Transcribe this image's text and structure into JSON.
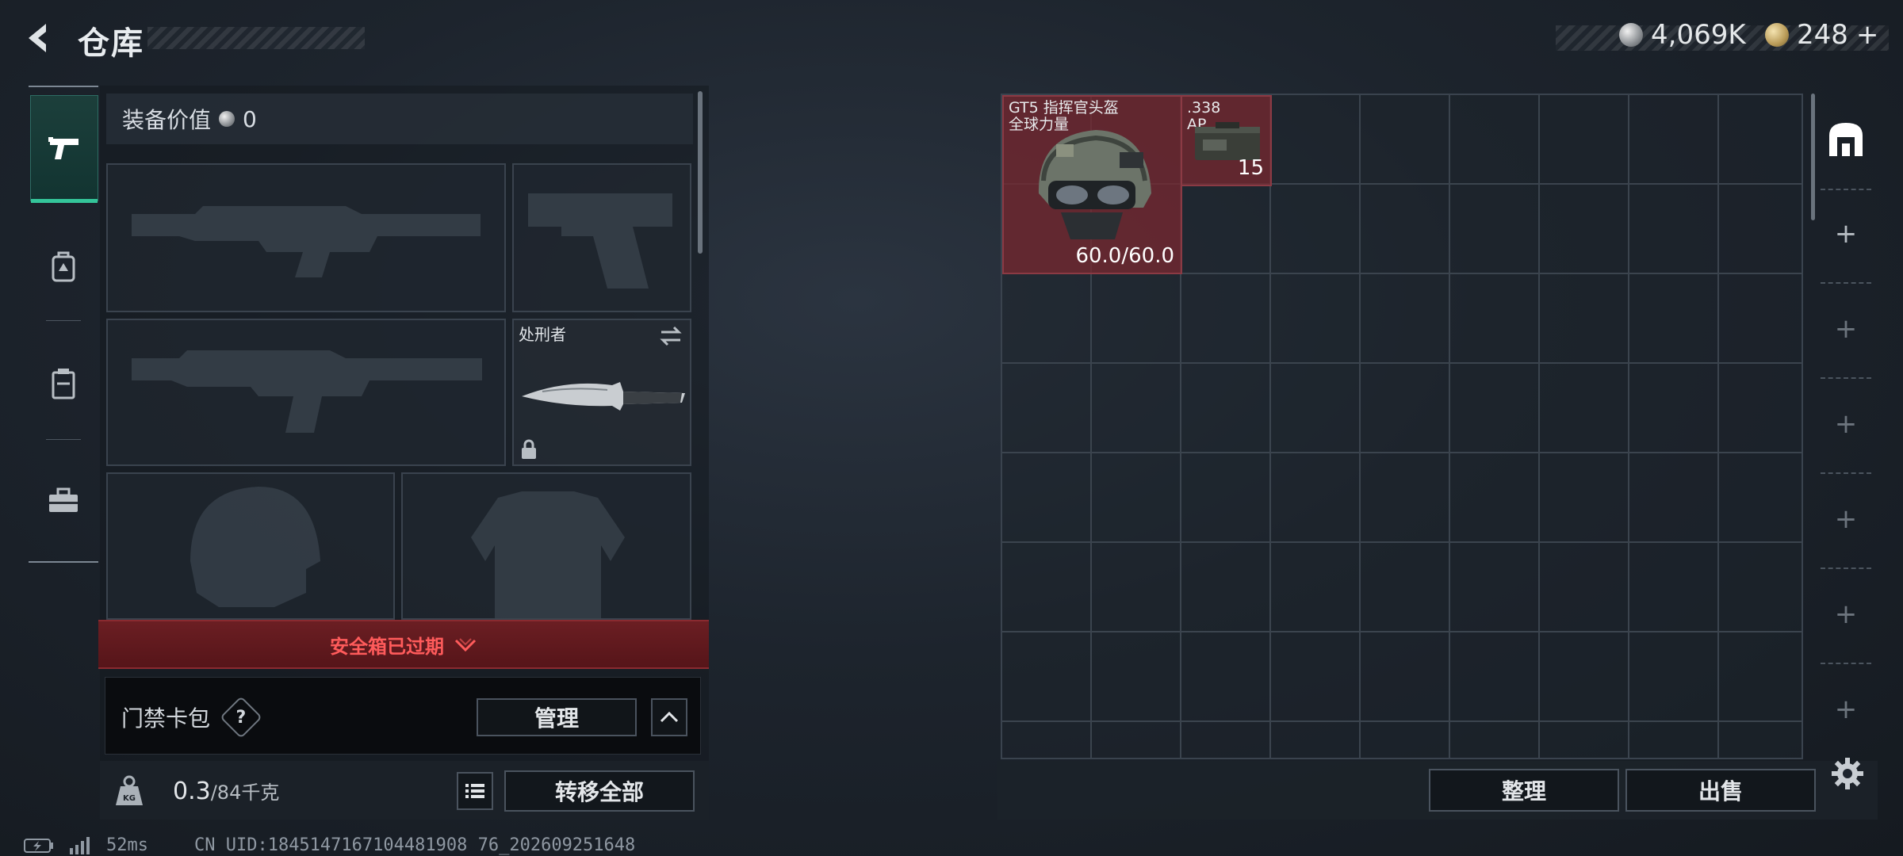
{
  "header": {
    "title": "仓库",
    "currency_silver": "4,069K",
    "currency_gold": "248",
    "plus": "+"
  },
  "nav": {
    "items": [
      {
        "name": "weapon-tab",
        "icon": "pistol-icon",
        "active": true
      },
      {
        "name": "backpack-tab",
        "icon": "backpack-icon",
        "active": false
      },
      {
        "name": "container-tab",
        "icon": "crate-icon",
        "active": false
      },
      {
        "name": "toolbox-tab",
        "icon": "toolbox-icon",
        "active": false
      }
    ]
  },
  "equipment": {
    "value_label": "装备价值",
    "value": "0",
    "melee_name": "处刑者"
  },
  "safe_box": {
    "status": "安全箱已过期"
  },
  "keycard": {
    "label": "门禁卡包",
    "help": "?",
    "manage_label": "管理"
  },
  "weight": {
    "current": "0.3",
    "max": "/84千克",
    "transfer_all_label": "转移全部"
  },
  "storage": {
    "items": [
      {
        "name_line1": "GT5 指挥官头盔",
        "name_line2": "全球力量",
        "durability": "60.0/60.0"
      },
      {
        "name_line1": ".338",
        "name_line2": "AP",
        "count": "15"
      }
    ],
    "sort_label": "整理",
    "sell_label": "出售"
  },
  "status_bar": {
    "ping": "52ms",
    "uid": "CN UID:1845147167104481908 76_202609251648"
  },
  "colors": {
    "accent_green": "#34c59a",
    "item_red": "#78282f",
    "warning_red": "#ff5b5b"
  }
}
